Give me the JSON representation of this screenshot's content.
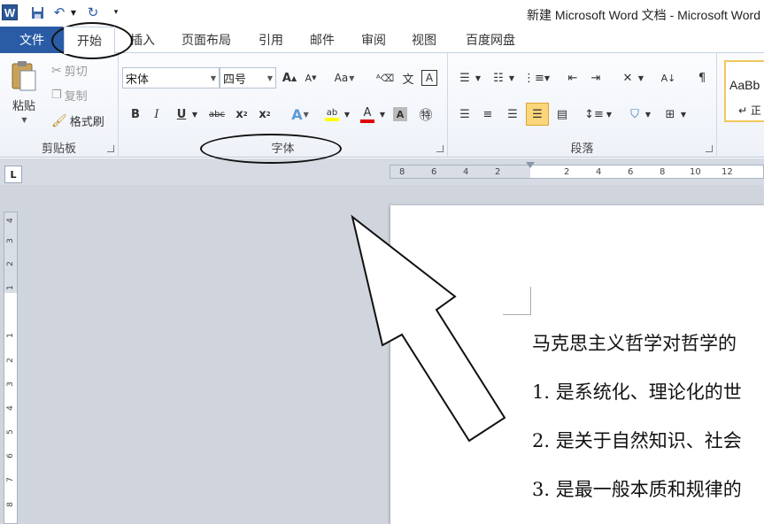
{
  "titlebar": {
    "title": "新建 Microsoft Word 文档 - Microsoft Word",
    "app_icon": "W"
  },
  "tabs": [
    {
      "label": "文件"
    },
    {
      "label": "开始"
    },
    {
      "label": "插入"
    },
    {
      "label": "页面布局"
    },
    {
      "label": "引用"
    },
    {
      "label": "邮件"
    },
    {
      "label": "审阅"
    },
    {
      "label": "视图"
    },
    {
      "label": "百度网盘"
    }
  ],
  "clipboard": {
    "paste": "粘贴",
    "cut": "剪切",
    "copy": "复制",
    "format_painter": "格式刷",
    "label": "剪贴板"
  },
  "font": {
    "name": "宋体",
    "size": "四号",
    "label": "字体"
  },
  "paragraph": {
    "label": "段落"
  },
  "styles": {
    "preview": "AaBb",
    "name": "↵ 正"
  },
  "ruler": {
    "h_ticks": [
      "8",
      "6",
      "4",
      "2",
      "2",
      "4",
      "6",
      "8",
      "10",
      "12"
    ],
    "v_ticks": [
      "4",
      "3",
      "2",
      "1",
      "1",
      "2",
      "3",
      "4",
      "5",
      "6",
      "7",
      "8"
    ]
  },
  "document": {
    "lines": [
      "马克思主义哲学对哲学的",
      "1. 是系统化、理论化的世",
      "2. 是关于自然知识、社会",
      "3. 是最一般本质和规律的"
    ]
  },
  "colors": {
    "file_tab": "#2a5ca6",
    "highlight": "#ffff00",
    "font_color": "#e00000"
  }
}
